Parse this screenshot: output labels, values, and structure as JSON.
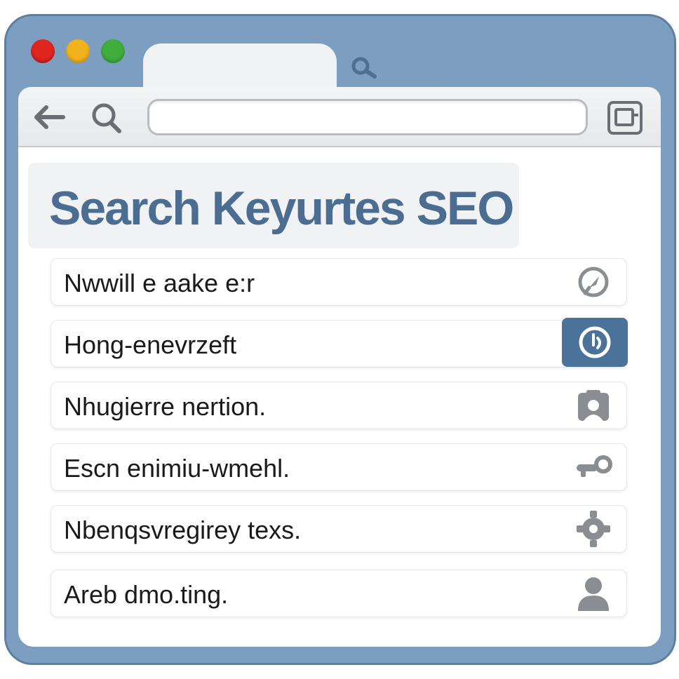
{
  "window": {
    "controls": [
      "close",
      "minimize",
      "maximize"
    ],
    "tab_icon": "search-icon"
  },
  "toolbar": {
    "back_icon": "back-arrow-icon",
    "search_icon": "search-icon",
    "url_value": "",
    "menu_icon": "window-icon"
  },
  "page": {
    "title": "Search Keyurtes SEO"
  },
  "results": [
    {
      "label": "Nwwill e aake e:r",
      "icon": "compass-icon",
      "active": false
    },
    {
      "label": "Hong-enevrzeft",
      "icon": "clock-icon",
      "active": true
    },
    {
      "label": "Nhugierre nertion.",
      "icon": "user-frame-icon",
      "active": false
    },
    {
      "label": "Escn enimiu-wmehl.",
      "icon": "key-icon",
      "active": false
    },
    {
      "label": "Nbenqsvregirey texs.",
      "icon": "gear-icon",
      "active": false
    },
    {
      "label": "Areb dmo.ting.",
      "icon": "person-icon",
      "active": false
    }
  ],
  "colors": {
    "frame": "#7c9fc1",
    "title": "#4a6d91",
    "accent": "#4b7299",
    "icon_gray": "#8a8d91"
  }
}
